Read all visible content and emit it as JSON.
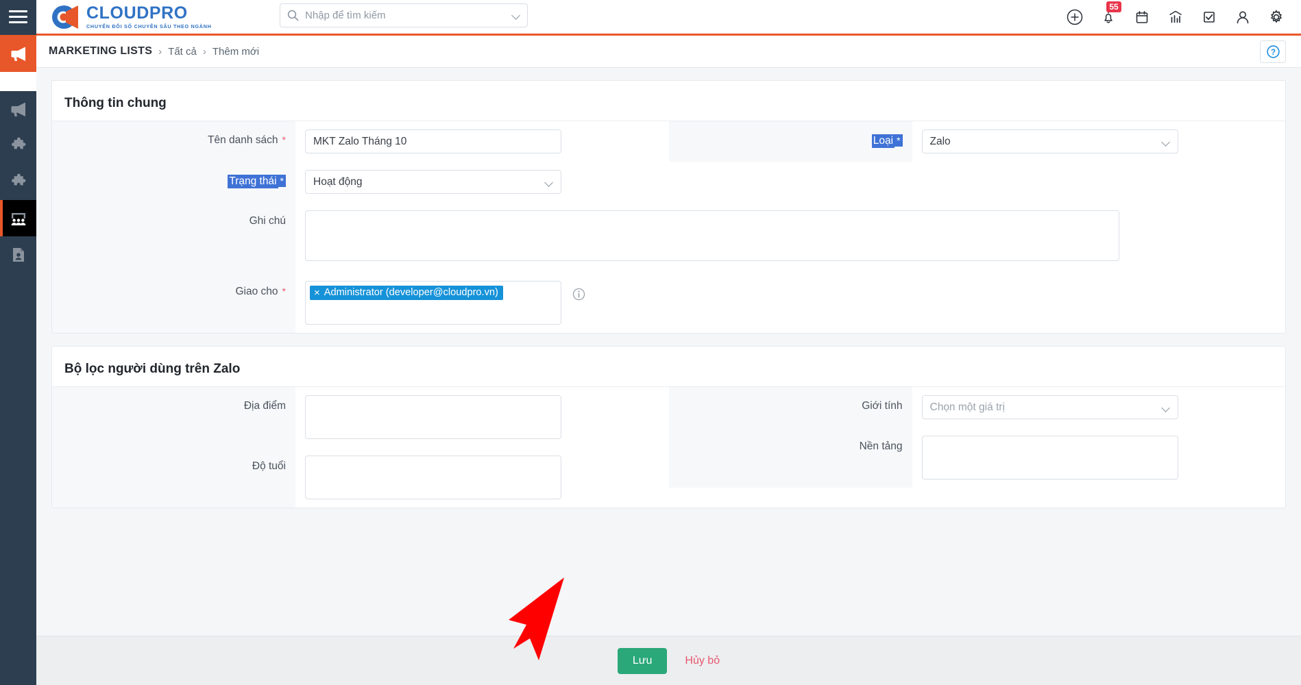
{
  "brand": {
    "name": "CLOUDPRO",
    "tagline": "CHUYỂN ĐỔI SỐ CHUYÊN SÂU THEO NGÀNH"
  },
  "colors": {
    "brand_blue": "#2f72c4",
    "brand_orange": "#e8572a",
    "sidebar": "#2d3e50",
    "save_green": "#2aa879",
    "cancel_red": "#e8566f",
    "selection_blue": "#3f72d6",
    "chip_blue": "#1692d8",
    "badge_red": "#e8344a",
    "annotation_arrow": "#ff0000"
  },
  "topbar": {
    "menu_icon": "hamburger-icon",
    "search": {
      "placeholder": "Nhập để tìm kiếm",
      "value": ""
    },
    "icons": [
      {
        "name": "add-circle-icon",
        "label": ""
      },
      {
        "name": "notifications-bell-icon",
        "label": "",
        "badge": "55"
      },
      {
        "name": "calendar-icon",
        "label": ""
      },
      {
        "name": "analytics-chart-icon",
        "label": ""
      },
      {
        "name": "tasks-checkbox-icon",
        "label": ""
      },
      {
        "name": "user-account-icon",
        "label": ""
      },
      {
        "name": "settings-gear-icon",
        "label": ""
      }
    ]
  },
  "sidebar": {
    "items": [
      {
        "name": "sidebar-item-campaign-active",
        "icon": "megaphone-icon",
        "state": "active-orange"
      },
      {
        "name": "sidebar-item-marketing",
        "icon": "megaphone-icon",
        "state": "normal"
      },
      {
        "name": "sidebar-item-module-1",
        "icon": "puzzle-icon",
        "state": "normal"
      },
      {
        "name": "sidebar-item-module-2",
        "icon": "puzzle-icon",
        "state": "normal"
      },
      {
        "name": "sidebar-item-marketing-lists",
        "icon": "audience-group-icon",
        "state": "active-dark"
      },
      {
        "name": "sidebar-item-contacts",
        "icon": "contact-card-icon",
        "state": "normal"
      }
    ]
  },
  "breadcrumb": {
    "title": "MARKETING LISTS",
    "separator": "›",
    "parent": "Tất cả",
    "current": "Thêm mới",
    "help_icon": "help-question-icon"
  },
  "sections": [
    {
      "title": "Thông tin chung",
      "fields": [
        {
          "key": "ten_danh_sach",
          "label": "Tên danh sách",
          "required": true,
          "selected": false,
          "control": "text",
          "value": "MKT Zalo Tháng 10",
          "placeholder": "",
          "column": "left"
        },
        {
          "key": "loai",
          "label": "Loại",
          "required": true,
          "selected": true,
          "control": "select",
          "value": "Zalo",
          "placeholder": "",
          "column": "right"
        },
        {
          "key": "trang_thai",
          "label": "Trạng thái",
          "required": true,
          "selected": true,
          "control": "select",
          "value": "Hoạt động",
          "placeholder": "",
          "column": "left"
        },
        {
          "key": "ghi_chu",
          "label": "Ghi chú",
          "required": false,
          "selected": false,
          "control": "textarea",
          "value": "",
          "placeholder": "",
          "column": "full"
        },
        {
          "key": "giao_cho",
          "label": "Giao cho",
          "required": true,
          "selected": false,
          "control": "tags",
          "value": "",
          "tags": [
            {
              "remove": "×",
              "text": "Administrator (developer@cloudpro.vn)"
            }
          ],
          "info_icon": "info-circle-icon",
          "column": "left"
        }
      ]
    },
    {
      "title": "Bộ lọc người dùng trên Zalo",
      "fields": [
        {
          "key": "dia_diem",
          "label": "Địa điểm",
          "required": false,
          "selected": false,
          "control": "box",
          "value": "",
          "placeholder": "",
          "column": "left"
        },
        {
          "key": "gioi_tinh",
          "label": "Giới tính",
          "required": false,
          "selected": false,
          "control": "select",
          "value": "",
          "placeholder": "Chọn một giá trị",
          "column": "right"
        },
        {
          "key": "do_tuoi",
          "label": "Độ tuổi",
          "required": false,
          "selected": false,
          "control": "box",
          "value": "",
          "placeholder": "",
          "column": "left"
        },
        {
          "key": "nen_tang",
          "label": "Nền tảng",
          "required": false,
          "selected": false,
          "control": "box",
          "value": "",
          "placeholder": "",
          "column": "right"
        }
      ]
    }
  ],
  "footer": {
    "save_label": "Lưu",
    "cancel_label": "Hủy bỏ"
  },
  "annotation": {
    "type": "arrow",
    "points_to": "save-button"
  }
}
